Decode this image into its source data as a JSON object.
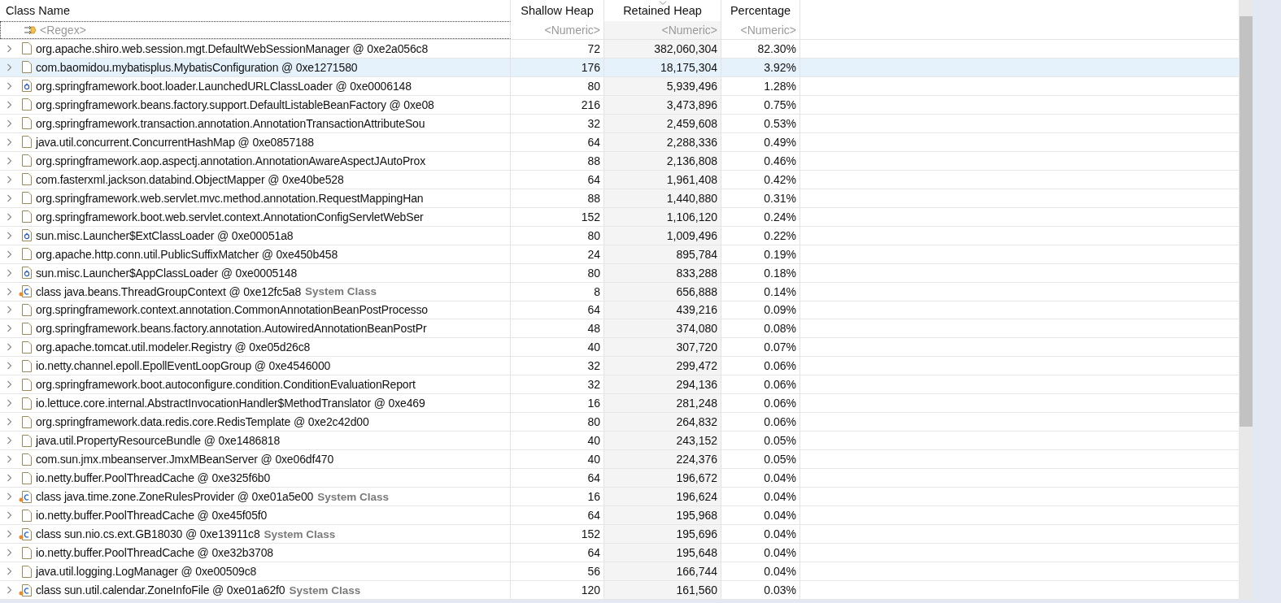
{
  "columns": [
    {
      "label": "Class Name",
      "sorted": false
    },
    {
      "label": "Shallow Heap",
      "sorted": false
    },
    {
      "label": "Retained Heap",
      "sorted": true
    },
    {
      "label": "Percentage",
      "sorted": false
    }
  ],
  "filters": [
    {
      "placeholder": "<Regex>"
    },
    {
      "placeholder": "<Numeric>"
    },
    {
      "placeholder": "<Numeric>"
    },
    {
      "placeholder": "<Numeric>"
    }
  ],
  "rows": [
    {
      "kind": "object",
      "name": "org.apache.shiro.web.session.mgt.DefaultWebSessionManager @ 0xe2a056c8",
      "shallow": "72",
      "retained": "382,060,304",
      "percentage": "82.30%",
      "selected": false
    },
    {
      "kind": "object",
      "name": "com.baomidou.mybatisplus.MybatisConfiguration @ 0xe1271580",
      "shallow": "176",
      "retained": "18,175,304",
      "percentage": "3.92%",
      "selected": true
    },
    {
      "kind": "classloader",
      "name": "org.springframework.boot.loader.LaunchedURLClassLoader @ 0xe0006148",
      "shallow": "80",
      "retained": "5,939,496",
      "percentage": "1.28%",
      "selected": false
    },
    {
      "kind": "object",
      "name": "org.springframework.beans.factory.support.DefaultListableBeanFactory @ 0xe08",
      "shallow": "216",
      "retained": "3,473,896",
      "percentage": "0.75%",
      "selected": false
    },
    {
      "kind": "object",
      "name": "org.springframework.transaction.annotation.AnnotationTransactionAttributeSou",
      "shallow": "32",
      "retained": "2,459,608",
      "percentage": "0.53%",
      "selected": false
    },
    {
      "kind": "object",
      "name": "java.util.concurrent.ConcurrentHashMap @ 0xe0857188",
      "shallow": "64",
      "retained": "2,288,336",
      "percentage": "0.49%",
      "selected": false
    },
    {
      "kind": "object",
      "name": "org.springframework.aop.aspectj.annotation.AnnotationAwareAspectJAutoProx",
      "shallow": "88",
      "retained": "2,136,808",
      "percentage": "0.46%",
      "selected": false
    },
    {
      "kind": "object",
      "name": "com.fasterxml.jackson.databind.ObjectMapper @ 0xe40be528",
      "shallow": "64",
      "retained": "1,961,408",
      "percentage": "0.42%",
      "selected": false
    },
    {
      "kind": "object",
      "name": "org.springframework.web.servlet.mvc.method.annotation.RequestMappingHan",
      "shallow": "88",
      "retained": "1,440,880",
      "percentage": "0.31%",
      "selected": false
    },
    {
      "kind": "object",
      "name": "org.springframework.boot.web.servlet.context.AnnotationConfigServletWebSer",
      "shallow": "152",
      "retained": "1,106,120",
      "percentage": "0.24%",
      "selected": false
    },
    {
      "kind": "classloader",
      "name": "sun.misc.Launcher$ExtClassLoader @ 0xe00051a8",
      "shallow": "80",
      "retained": "1,009,496",
      "percentage": "0.22%",
      "selected": false
    },
    {
      "kind": "object",
      "name": "org.apache.http.conn.util.PublicSuffixMatcher @ 0xe450b458",
      "shallow": "24",
      "retained": "895,784",
      "percentage": "0.19%",
      "selected": false
    },
    {
      "kind": "classloader",
      "name": "sun.misc.Launcher$AppClassLoader @ 0xe0005148",
      "shallow": "80",
      "retained": "833,288",
      "percentage": "0.18%",
      "selected": false
    },
    {
      "kind": "class",
      "name": "class java.beans.ThreadGroupContext @ 0xe12fc5a8",
      "suffix": "System Class",
      "shallow": "8",
      "retained": "656,888",
      "percentage": "0.14%",
      "selected": false
    },
    {
      "kind": "object",
      "name": "org.springframework.context.annotation.CommonAnnotationBeanPostProcesso",
      "shallow": "64",
      "retained": "439,216",
      "percentage": "0.09%",
      "selected": false
    },
    {
      "kind": "object",
      "name": "org.springframework.beans.factory.annotation.AutowiredAnnotationBeanPostPr",
      "shallow": "48",
      "retained": "374,080",
      "percentage": "0.08%",
      "selected": false
    },
    {
      "kind": "object",
      "name": "org.apache.tomcat.util.modeler.Registry @ 0xe05d26c8",
      "shallow": "40",
      "retained": "307,720",
      "percentage": "0.07%",
      "selected": false
    },
    {
      "kind": "object",
      "name": "io.netty.channel.epoll.EpollEventLoopGroup @ 0xe4546000",
      "shallow": "32",
      "retained": "299,472",
      "percentage": "0.06%",
      "selected": false
    },
    {
      "kind": "object",
      "name": "org.springframework.boot.autoconfigure.condition.ConditionEvaluationReport",
      "shallow": "32",
      "retained": "294,136",
      "percentage": "0.06%",
      "selected": false
    },
    {
      "kind": "object",
      "name": "io.lettuce.core.internal.AbstractInvocationHandler$MethodTranslator @ 0xe469",
      "shallow": "16",
      "retained": "281,248",
      "percentage": "0.06%",
      "selected": false
    },
    {
      "kind": "object",
      "name": "org.springframework.data.redis.core.RedisTemplate @ 0xe2c42d00",
      "shallow": "80",
      "retained": "264,832",
      "percentage": "0.06%",
      "selected": false
    },
    {
      "kind": "object",
      "name": "java.util.PropertyResourceBundle @ 0xe1486818",
      "shallow": "40",
      "retained": "243,152",
      "percentage": "0.05%",
      "selected": false
    },
    {
      "kind": "object",
      "name": "com.sun.jmx.mbeanserver.JmxMBeanServer @ 0xe06df470",
      "shallow": "40",
      "retained": "224,376",
      "percentage": "0.05%",
      "selected": false
    },
    {
      "kind": "object",
      "name": "io.netty.buffer.PoolThreadCache @ 0xe325f6b0",
      "shallow": "64",
      "retained": "196,672",
      "percentage": "0.04%",
      "selected": false
    },
    {
      "kind": "class",
      "name": "class java.time.zone.ZoneRulesProvider @ 0xe01a5e00",
      "suffix": "System Class",
      "shallow": "16",
      "retained": "196,624",
      "percentage": "0.04%",
      "selected": false
    },
    {
      "kind": "object",
      "name": "io.netty.buffer.PoolThreadCache @ 0xe45f05f0",
      "shallow": "64",
      "retained": "195,968",
      "percentage": "0.04%",
      "selected": false
    },
    {
      "kind": "class",
      "name": "class sun.nio.cs.ext.GB18030 @ 0xe13911c8",
      "suffix": "System Class",
      "shallow": "152",
      "retained": "195,696",
      "percentage": "0.04%",
      "selected": false
    },
    {
      "kind": "object",
      "name": "io.netty.buffer.PoolThreadCache @ 0xe32b3708",
      "shallow": "64",
      "retained": "195,648",
      "percentage": "0.04%",
      "selected": false
    },
    {
      "kind": "object",
      "name": "java.util.logging.LogManager @ 0xe00509c8",
      "shallow": "56",
      "retained": "166,744",
      "percentage": "0.04%",
      "selected": false
    },
    {
      "kind": "class",
      "name": "class sun.util.calendar.ZoneInfoFile @ 0xe01a62f0",
      "suffix": "System Class",
      "shallow": "120",
      "retained": "161,560",
      "percentage": "0.03%",
      "selected": false
    }
  ]
}
